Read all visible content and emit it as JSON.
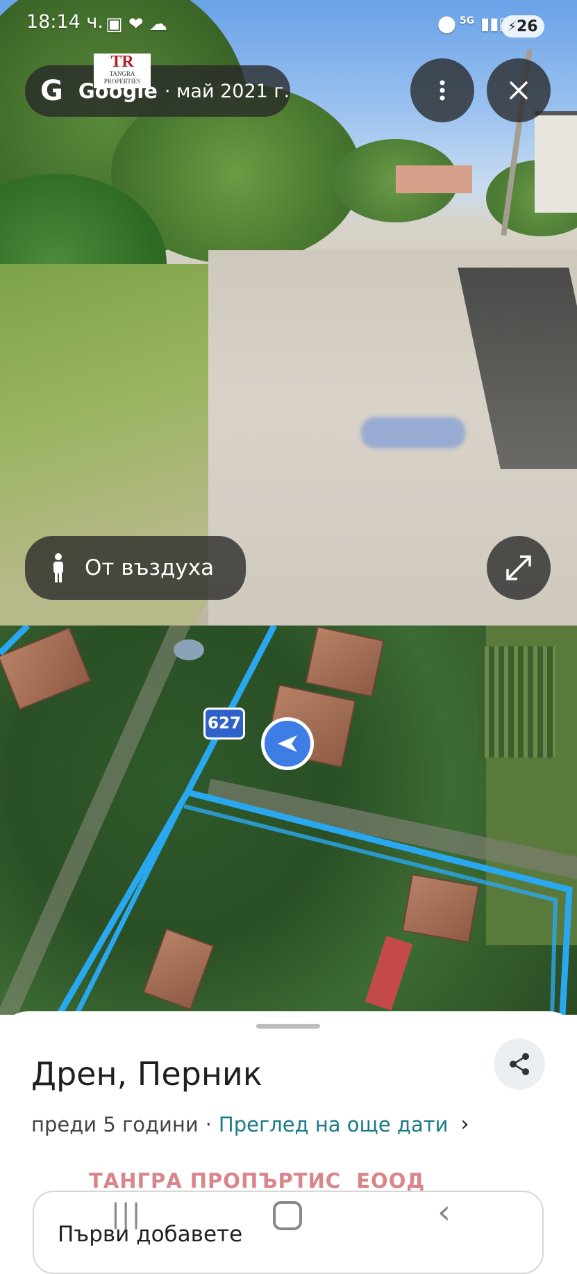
{
  "status": {
    "time": "18:14 ч.",
    "network": "5G",
    "battery": "26"
  },
  "street_view": {
    "logo_text": "Google",
    "date": "· май 2021 г.",
    "watermark": {
      "line1": "TR",
      "line2": "TANGRA",
      "line3": "PROPERTIES"
    },
    "aerial_button_label": "От въздуха",
    "icons": {
      "more": "more-vert-icon",
      "close": "close-icon",
      "expand": "expand-icon",
      "pegman": "pegman-icon"
    }
  },
  "map": {
    "road_badge": "627",
    "colors": {
      "route": "#29a8f0",
      "arrow": "#3f7de6"
    }
  },
  "sheet": {
    "title": "Дрен, Перник",
    "subtitle_age": "преди 5 години",
    "separator": "·",
    "more_dates_link": "Преглед на още дати",
    "watermark_text": "ТАНГРА ПРОПЪРТИС  ЕООД",
    "card_label": "Първи добавете"
  },
  "navbar": {
    "icons": [
      "recents-icon",
      "home-icon",
      "back-icon"
    ]
  },
  "colors": {
    "link": "#1a7a8a",
    "watermark_red": "#d9868a"
  }
}
